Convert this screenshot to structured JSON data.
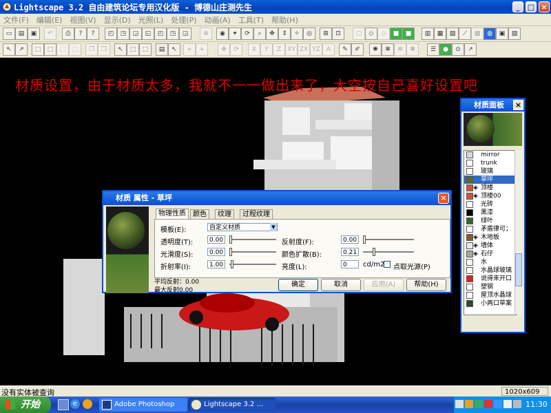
{
  "window": {
    "title": "Lightscape 3.2 自由建筑论坛专用汉化版  - 博德山庄测先生",
    "buttons": [
      "_",
      "□",
      "×"
    ]
  },
  "menubar": [
    "文件(F)",
    "编辑(E)",
    "视图(V)",
    "显示(D)",
    "光照(L)",
    "处理(P)",
    "动画(A)",
    "工具(T)",
    "帮助(H)"
  ],
  "viewport": {
    "banner": "材质设置，由于材质太多，我就不一一做出来了，大空按自己喜好设置吧"
  },
  "material_panel": {
    "title": "材质面板",
    "items": [
      {
        "label": "mirror",
        "color": "#d8d8d8"
      },
      {
        "label": "trunk",
        "color": "#ffffff"
      },
      {
        "label": "玻璃",
        "color": "#ffffff"
      },
      {
        "label": "草坪",
        "color": "#5a6a2a",
        "selected": true
      },
      {
        "label": "顶楼",
        "color": "#c85a3a",
        "cube": true
      },
      {
        "label": "顶楼00",
        "color": "#c85a3a",
        "cube": true
      },
      {
        "label": "光砖",
        "color": "#ffffff"
      },
      {
        "label": "黑漆",
        "color": "#000000"
      },
      {
        "label": "绿叶",
        "color": "#2a6a2a"
      },
      {
        "label": "矛盾律可；",
        "color": "#ffffff"
      },
      {
        "label": "木地板",
        "color": "#8a5a2a",
        "cube": true
      },
      {
        "label": "墙体",
        "color": "#e8e8e8",
        "cube": true
      },
      {
        "label": "石仔",
        "color": "#a8a898",
        "cube": true
      },
      {
        "label": "水",
        "color": "#ffffff"
      },
      {
        "label": "水晶球玻璃",
        "color": "#ffffff"
      },
      {
        "label": "说得来开口",
        "color": "#e02020"
      },
      {
        "label": "塑钢",
        "color": "#ffffff"
      },
      {
        "label": "屋顶水晶球",
        "color": "#ffffff"
      },
      {
        "label": "小两口草案",
        "color": "#2a4a2a"
      }
    ]
  },
  "material_dialog": {
    "title": "材质 属性 - 草坪",
    "tabs": [
      "物理性质",
      "颜色",
      "纹理",
      "过程纹理"
    ],
    "template_label": "模板(E):",
    "template_value": "自定义材质",
    "fields": {
      "transparency": {
        "label": "透明度(T):",
        "value": "0.00"
      },
      "smoothness": {
        "label": "光滑度(S):",
        "value": "0.00"
      },
      "refraction": {
        "label": "折射率(I):",
        "value": "1.00"
      },
      "reflectance": {
        "label": "反射度(F):",
        "value": "0.00"
      },
      "color_bleed": {
        "label": "颜色扩散(B):",
        "value": "0.21"
      },
      "luminance": {
        "label": "亮度(L):",
        "value": "0",
        "unit": "cd/m2"
      }
    },
    "point_light_label": "点取光源(P)",
    "avg_reflect": "平均反射：0.00",
    "max_reflect": "最大反射0.00",
    "buttons": {
      "ok": "确定",
      "cancel": "取消",
      "apply": "应用(A)",
      "help": "帮助(H)"
    }
  },
  "statusbar": {
    "left": "没有实体被查询",
    "right": "1020x609"
  },
  "taskbar": {
    "start": "开始",
    "items": [
      "Adobe Photoshop",
      "Lightscape 3.2 ..."
    ],
    "clock": "11:30"
  }
}
